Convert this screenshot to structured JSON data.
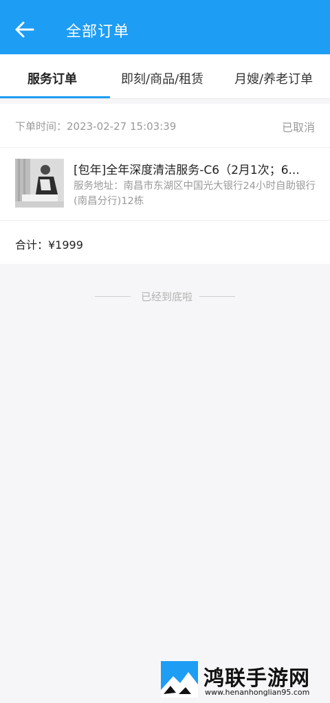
{
  "header": {
    "title": "全部订单",
    "back_icon": "arrow-left-icon"
  },
  "tabs": [
    {
      "label": "服务订单",
      "active": true
    },
    {
      "label": "即刻/商品/租赁",
      "active": false
    },
    {
      "label": "月嫂/养老订单",
      "active": false
    }
  ],
  "order": {
    "time": "下单时间：2023-02-27 15:03:39",
    "status": "已取消",
    "item_title": "[包年]全年深度清洁服务-C6（2月1次；6...",
    "item_address": "服务地址：南昌市东湖区中国光大银行24小时自助银行(南昌分行)12栋",
    "total": "合计：¥1999"
  },
  "footer": {
    "end_text": "已经到底啦"
  },
  "watermark": {
    "text": "鸿联手游网",
    "url": "www.henanhonglian95.com"
  },
  "colors": {
    "accent": "#1e9df4",
    "muted": "#9a9a9a"
  }
}
